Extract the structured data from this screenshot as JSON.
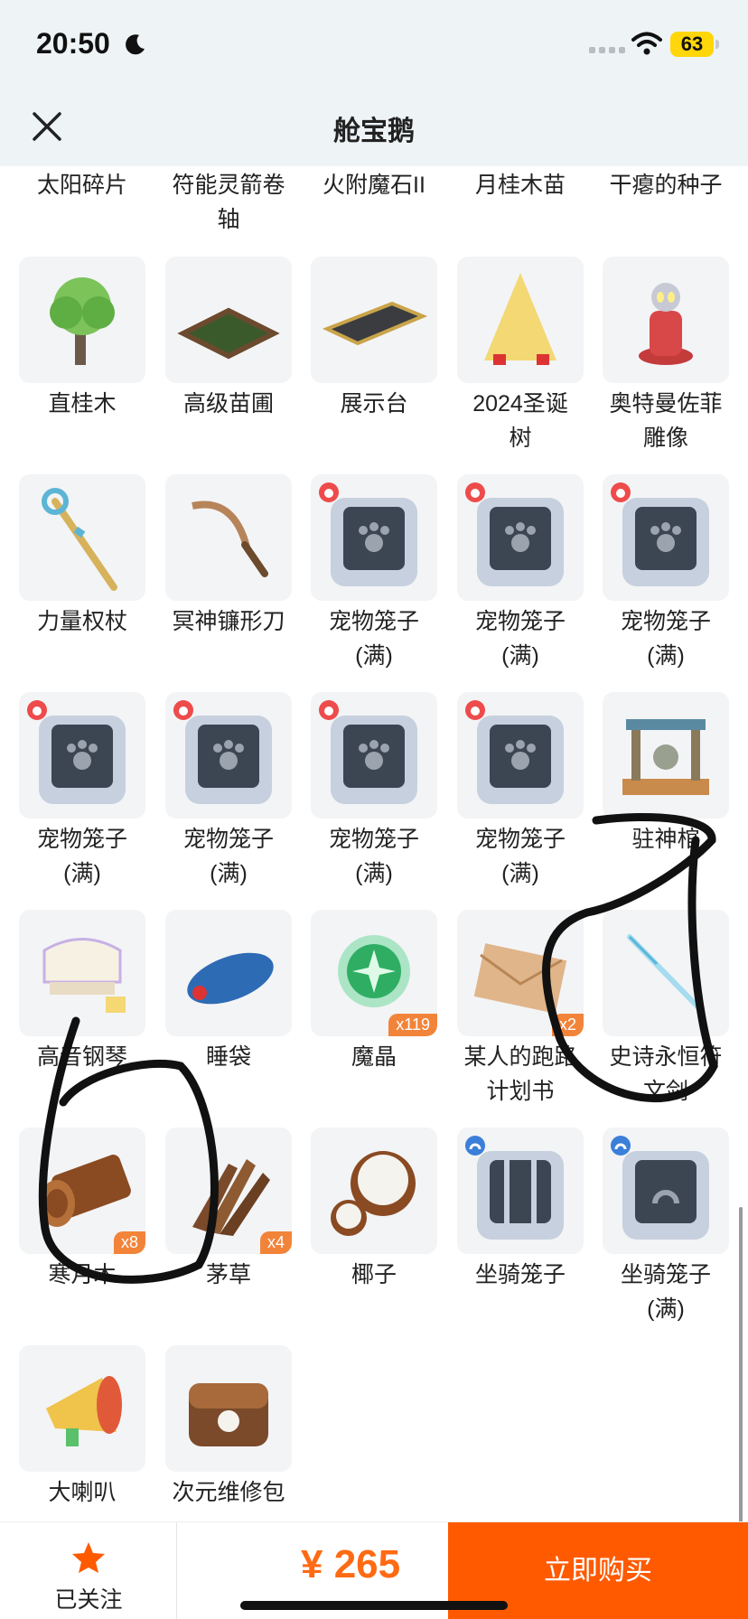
{
  "status": {
    "time": "20:50",
    "battery": "63"
  },
  "header": {
    "title": "舱宝鹅"
  },
  "partial_row": [
    "太阳碎片",
    "符能灵箭卷\n轴",
    "火附魔石II",
    "月桂木苗",
    "干瘪的种子"
  ],
  "items": [
    {
      "name": "直桂木",
      "icon": "tree-icon"
    },
    {
      "name": "高级苗圃",
      "icon": "nursery-icon"
    },
    {
      "name": "展示台",
      "icon": "display-stand-icon"
    },
    {
      "name": "2024圣诞\n树",
      "icon": "christmas-tree-icon"
    },
    {
      "name": "奥特曼佐菲\n雕像",
      "icon": "ultraman-statue-icon"
    },
    {
      "name": "力量权杖",
      "icon": "scepter-icon"
    },
    {
      "name": "冥神镰形刀",
      "icon": "sickle-sword-icon"
    },
    {
      "name": "宠物笼子\n(满)",
      "icon": "pet-cage-icon"
    },
    {
      "name": "宠物笼子\n(满)",
      "icon": "pet-cage-icon"
    },
    {
      "name": "宠物笼子\n(满)",
      "icon": "pet-cage-icon"
    },
    {
      "name": "宠物笼子\n(满)",
      "icon": "pet-cage-icon"
    },
    {
      "name": "宠物笼子\n(满)",
      "icon": "pet-cage-icon"
    },
    {
      "name": "宠物笼子\n(满)",
      "icon": "pet-cage-icon"
    },
    {
      "name": "宠物笼子\n(满)",
      "icon": "pet-cage-icon"
    },
    {
      "name": "驻神棺",
      "icon": "shrine-icon"
    },
    {
      "name": "高音钢琴",
      "icon": "piano-icon"
    },
    {
      "name": "睡袋",
      "icon": "sleeping-bag-icon"
    },
    {
      "name": "魔晶",
      "icon": "magic-crystal-icon",
      "qty": "x119"
    },
    {
      "name": "某人的跑路\n计划书",
      "icon": "envelope-icon",
      "qty": "x2"
    },
    {
      "name": "史诗永恒符\n文剑",
      "icon": "rune-sword-icon"
    },
    {
      "name": "寒月木",
      "icon": "log-icon",
      "qty": "x8"
    },
    {
      "name": "茅草",
      "icon": "thatch-icon",
      "qty": "x4"
    },
    {
      "name": "椰子",
      "icon": "coconut-icon"
    },
    {
      "name": "坐骑笼子",
      "icon": "mount-cage-icon"
    },
    {
      "name": "坐骑笼子\n(满)",
      "icon": "mount-cage-full-icon"
    },
    {
      "name": "大喇叭",
      "icon": "megaphone-icon"
    },
    {
      "name": "次元维修包",
      "icon": "repair-bag-icon"
    }
  ],
  "bottom": {
    "follow_label": "已关注",
    "price": "¥ 265",
    "buy_label": "立即购买"
  },
  "colors": {
    "accent": "#ff5a00",
    "price": "#ff6a13",
    "qty_badge": "#f2843a"
  }
}
